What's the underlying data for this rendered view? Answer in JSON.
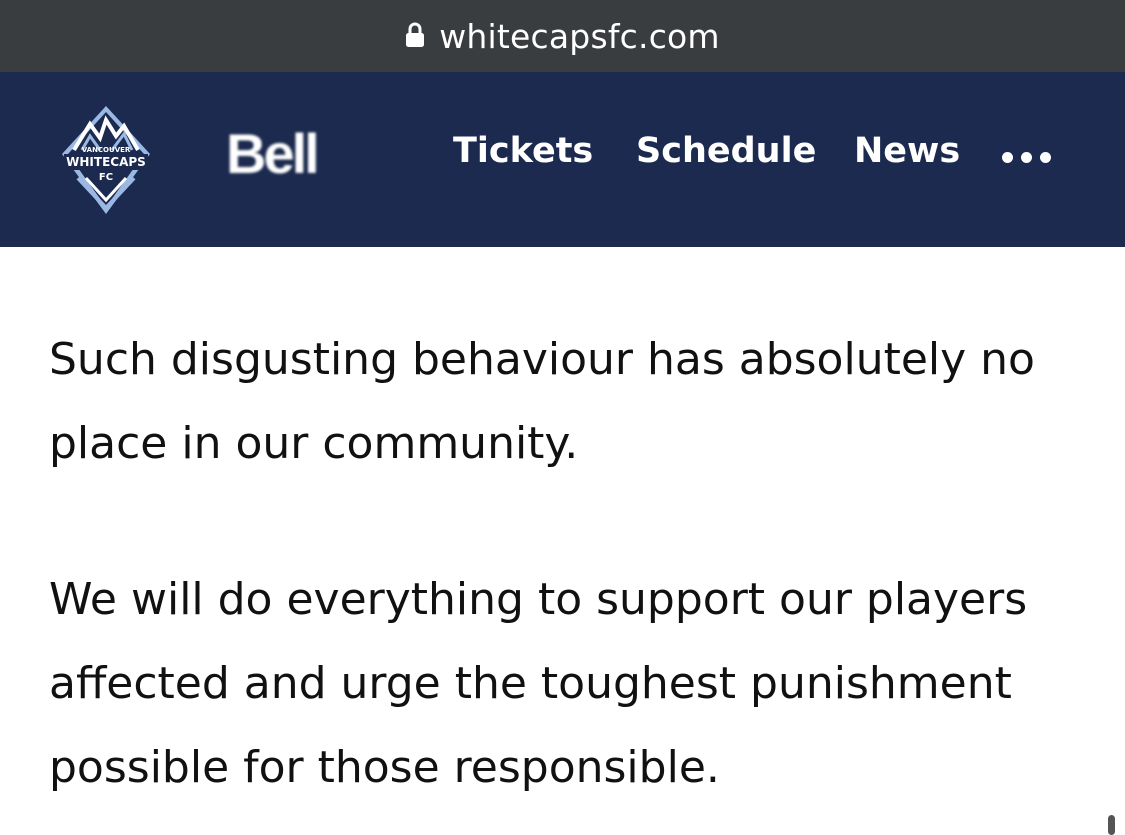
{
  "browser": {
    "url": "whitecapsfc.com",
    "lock_icon": "lock-icon"
  },
  "header": {
    "crest": {
      "line1": "VANCOUVER",
      "line2": "WHITECAPS",
      "line3": "FC"
    },
    "sponsor": "Bell",
    "nav": {
      "tickets": "Tickets",
      "schedule": "Schedule",
      "news": "News"
    },
    "more_icon": "more-dots-icon",
    "colors": {
      "header_bg": "#1b2a4e",
      "url_bar_bg": "#3a3d40",
      "crest_blue": "#9bb8e3"
    }
  },
  "article": {
    "paragraph1": "Such disgusting behaviour has absolutely no place in our community.",
    "paragraph2": "We will do everything to support our players affected and urge the toughest punishment possible for those responsible."
  }
}
